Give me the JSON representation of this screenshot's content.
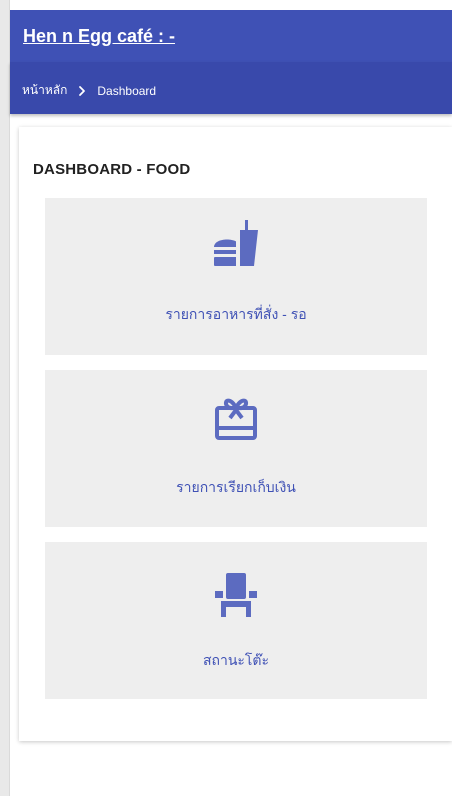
{
  "app": {
    "title": "Hen n Egg café : -"
  },
  "breadcrumb": {
    "home": "หน้าหลัก",
    "current": "Dashboard"
  },
  "dashboard": {
    "heading": "DASHBOARD - FOOD",
    "tiles": [
      {
        "label": "รายการอาหารที่สั่ง - รอ",
        "icon": "fastfood-icon"
      },
      {
        "label": "รายการเรียกเก็บเงิน",
        "icon": "gift-card-icon"
      },
      {
        "label": "สถานะโต๊ะ",
        "icon": "chair-icon"
      }
    ]
  },
  "colors": {
    "primary": "#3f51b5",
    "primary_dark": "#3949ab",
    "tile_bg": "#eeeeee",
    "icon": "#5c6bc0"
  }
}
